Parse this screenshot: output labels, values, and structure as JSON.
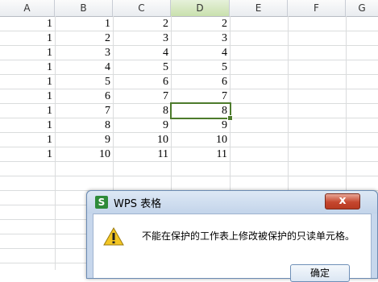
{
  "spreadsheet": {
    "columns": [
      {
        "label": "A"
      },
      {
        "label": "B"
      },
      {
        "label": "C"
      },
      {
        "label": "D",
        "selected": true
      },
      {
        "label": "E"
      },
      {
        "label": "F"
      },
      {
        "label": "G"
      }
    ],
    "rows": [
      [
        "1",
        "1",
        "2",
        "2"
      ],
      [
        "1",
        "2",
        "3",
        "3"
      ],
      [
        "1",
        "3",
        "4",
        "4"
      ],
      [
        "1",
        "4",
        "5",
        "5"
      ],
      [
        "1",
        "5",
        "6",
        "6"
      ],
      [
        "1",
        "6",
        "7",
        "7"
      ],
      [
        "1",
        "7",
        "8",
        "8"
      ],
      [
        "1",
        "8",
        "9",
        "9"
      ],
      [
        "1",
        "9",
        "10",
        "10"
      ],
      [
        "1",
        "10",
        "11",
        "11"
      ]
    ],
    "active_cell": "D8",
    "colors": {
      "selection": "#4d7b2c",
      "selected_header": "#c9e0ad",
      "grid": "#dadcdd"
    }
  },
  "dialog": {
    "title": "WPS 表格",
    "app_icon": "S",
    "close_label": "x",
    "icon": "warning-icon",
    "message": "不能在保护的工作表上修改被保护的只读单元格。",
    "ok_label": "确定"
  }
}
